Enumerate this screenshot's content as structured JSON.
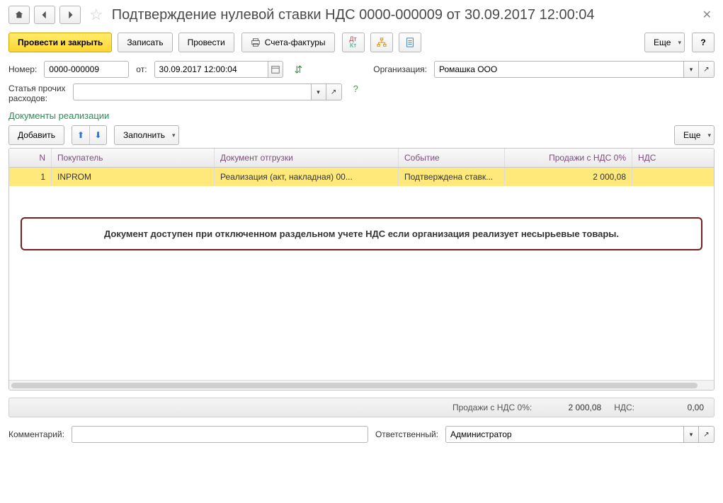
{
  "title": "Подтверждение нулевой ставки НДС 0000-000009 от 30.09.2017 12:00:04",
  "toolbar": {
    "post_and_close": "Провести и закрыть",
    "record": "Записать",
    "post": "Провести",
    "invoices": "Счета-фактуры",
    "more": "Еще"
  },
  "form": {
    "number_label": "Номер:",
    "number_value": "0000-000009",
    "from_label": "от:",
    "date_value": "30.09.2017 12:00:04",
    "org_label": "Организация:",
    "org_value": "Ромашка ООО",
    "expense_label_line1": "Статья прочих",
    "expense_label_line2": "расходов:",
    "expense_value": ""
  },
  "section_title": "Документы реализации",
  "table_toolbar": {
    "add": "Добавить",
    "fill": "Заполнить",
    "more": "Еще"
  },
  "grid": {
    "headers": {
      "n": "N",
      "buyer": "Покупатель",
      "doc": "Документ отгрузки",
      "event": "Событие",
      "sales": "Продажи с НДС 0%",
      "vat": "НДС"
    },
    "rows": [
      {
        "n": "1",
        "buyer": "INPROM",
        "doc": "Реализация (акт, накладная) 00...",
        "event": "Подтверждена ставк...",
        "sales": "2 000,08",
        "vat": ""
      }
    ]
  },
  "callout_text": "Документ доступен при отключенном раздельном учете НДС если организация реализует несырьевые товары.",
  "totals": {
    "sales_label": "Продажи с НДС 0%:",
    "sales_value": "2 000,08",
    "vat_label": "НДС:",
    "vat_value": "0,00"
  },
  "footer": {
    "comment_label": "Комментарий:",
    "comment_value": "",
    "responsible_label": "Ответственный:",
    "responsible_value": "Администратор"
  }
}
